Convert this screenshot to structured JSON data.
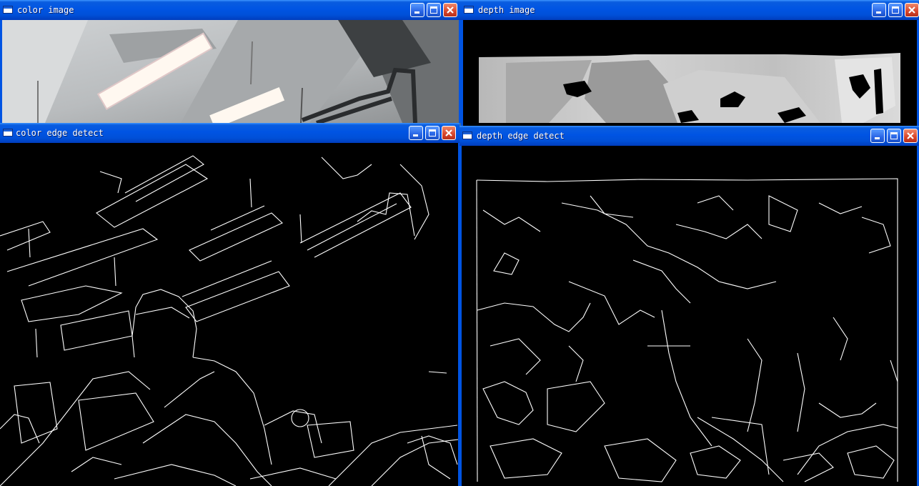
{
  "windows": {
    "color_image": {
      "title": "color image"
    },
    "depth_image": {
      "title": "depth image"
    },
    "color_edge": {
      "title": "color edge detect"
    },
    "depth_edge": {
      "title": "depth edge detect"
    }
  },
  "controls": {
    "minimize": "minimize-icon",
    "maximize": "maximize-icon",
    "close": "close-icon"
  },
  "colors": {
    "titlebar": "#0054e3",
    "close_button": "#d8452a",
    "edges": "#ffffff",
    "background": "#000000"
  }
}
